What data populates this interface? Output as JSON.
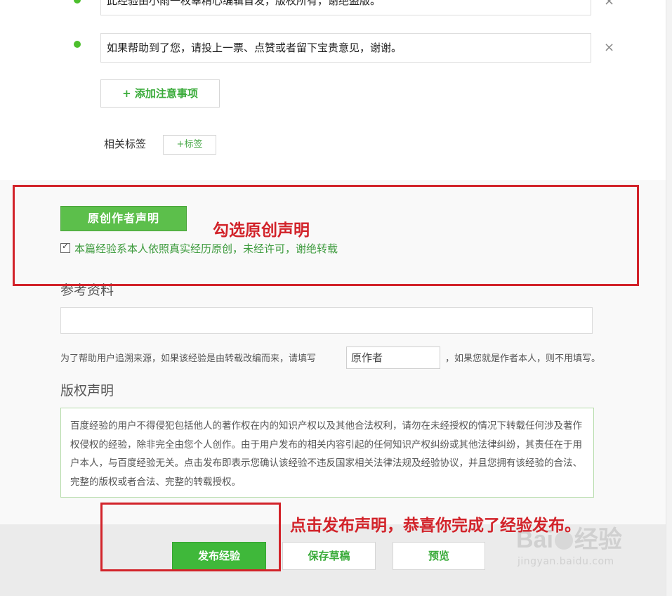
{
  "tips": {
    "items": [
      {
        "text": "此经验由小雨一枚辜精心编辑首发，版权所有，谢绝盗版。"
      },
      {
        "text": "如果帮助到了您，请投上一票、点赞或者留下宝贵意见，谢谢。"
      }
    ],
    "remove_glyph": "×",
    "add_button": "+ 添加注意事项"
  },
  "tags": {
    "label": "相关标签",
    "add_button": "+标签"
  },
  "original": {
    "button": "原创作者声明",
    "checkbox_label": "本篇经验系本人依照真实经历原创，未经许可，谢绝转载",
    "checked": true
  },
  "annotations": {
    "original_tip": "勾选原创声明",
    "publish_tip": "点击发布声明，恭喜你完成了经验发布。",
    "color": "#d2232a"
  },
  "reference": {
    "title": "参考资料",
    "input_value": "",
    "note_before": "为了帮助用户追溯来源，如果该经验是由转载改编而来，请填写",
    "author_placeholder": "原作者",
    "note_after": "，如果您就是作者本人，则不用填写。"
  },
  "copyright": {
    "title": "版权声明",
    "text": "百度经验的用户不得侵犯包括他人的著作权在内的知识产权以及其他合法权利，请勿在未经授权的情况下转载任何涉及著作权侵权的经验，除非完全由您个人创作。由于用户发布的相关内容引起的任何知识产权纠纷或其他法律纠纷，其责任在于用户本人，与百度经验无关。点击发布即表示您确认该经验不违反国家相关法律法规及经验协议，并且您拥有该经验的合法、完整的版权或者合法、完整的转载授权。"
  },
  "actions": {
    "publish": "发布经验",
    "save_draft": "保存草稿",
    "preview": "预览"
  },
  "watermark": {
    "logo": "Bai经验",
    "url": "jingyan.baidu.com"
  },
  "colors": {
    "accent_green": "#3fb83a",
    "annotation_red": "#d2232a"
  }
}
